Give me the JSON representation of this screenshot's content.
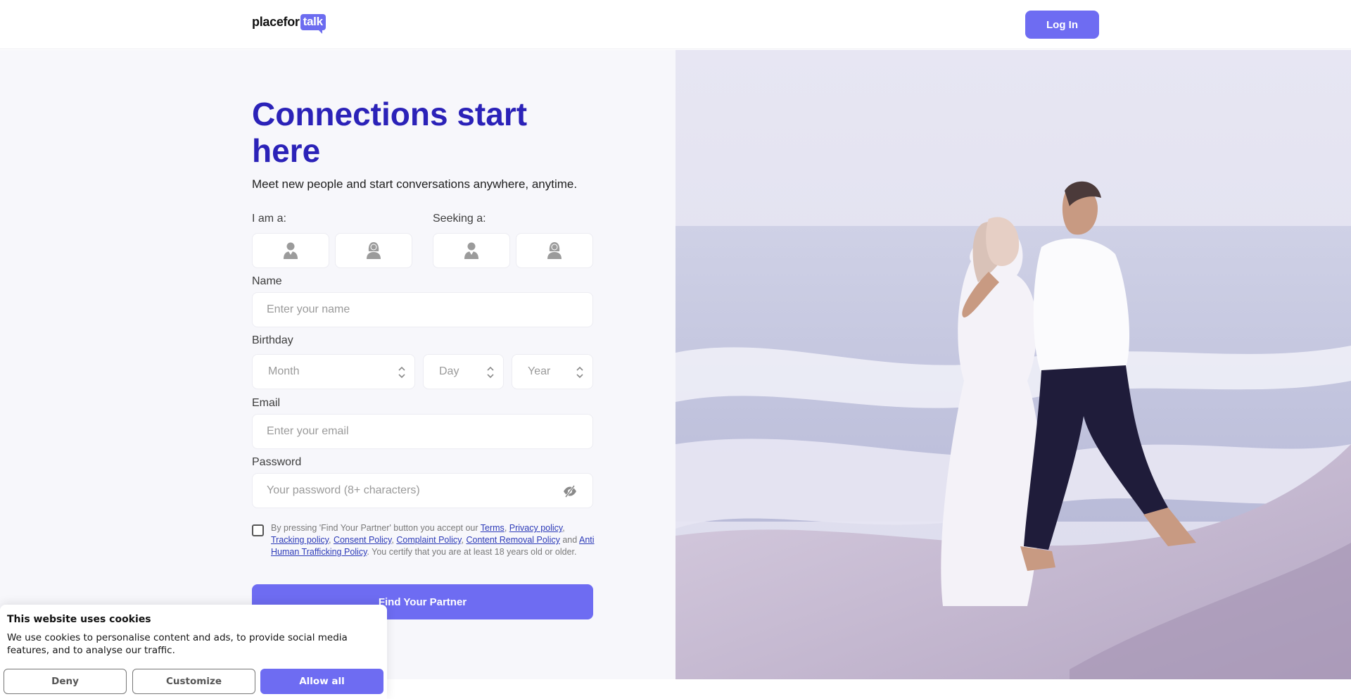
{
  "header": {
    "logo_place": "placefor",
    "logo_talk": "talk",
    "login_label": "Log In"
  },
  "hero": {
    "title": "Connections start here",
    "subtitle": "Meet new people and start conversations anywhere, anytime."
  },
  "form": {
    "i_am_label": "I am a:",
    "seeking_label": "Seeking a:",
    "name_label": "Name",
    "name_placeholder": "Enter your name",
    "birthday_label": "Birthday",
    "month_placeholder": "Month",
    "day_placeholder": "Day",
    "year_placeholder": "Year",
    "email_label": "Email",
    "email_placeholder": "Enter your email",
    "password_label": "Password",
    "password_placeholder": "Your password (8+ characters)",
    "terms": {
      "prefix": "By pressing 'Find Your Partner' button you accept our ",
      "terms_link": "Terms",
      "privacy_link": "Privacy policy",
      "tracking_link": "Tracking policy",
      "consent_link": "Consent Policy",
      "complaint_link": "Complaint Policy",
      "removal_link": "Content Removal Policy",
      "and": " and ",
      "trafficking_link": "Anti Human Trafficking Policy",
      "suffix": ". You certify that you are at least 18 years old or older."
    },
    "submit_label": "Find Your Partner"
  },
  "cookie": {
    "title": "This website uses cookies",
    "text": "We use cookies to personalise content and ads, to provide social media features, and to analyse our traffic.",
    "deny": "Deny",
    "customize": "Customize",
    "allow": "Allow all"
  },
  "colors": {
    "accent": "#6e6cf2",
    "title": "#2b22b8",
    "link": "#2d3bb8"
  },
  "icons": [
    "male-icon",
    "female-icon",
    "eye-slash-icon",
    "select-arrows-icon"
  ]
}
